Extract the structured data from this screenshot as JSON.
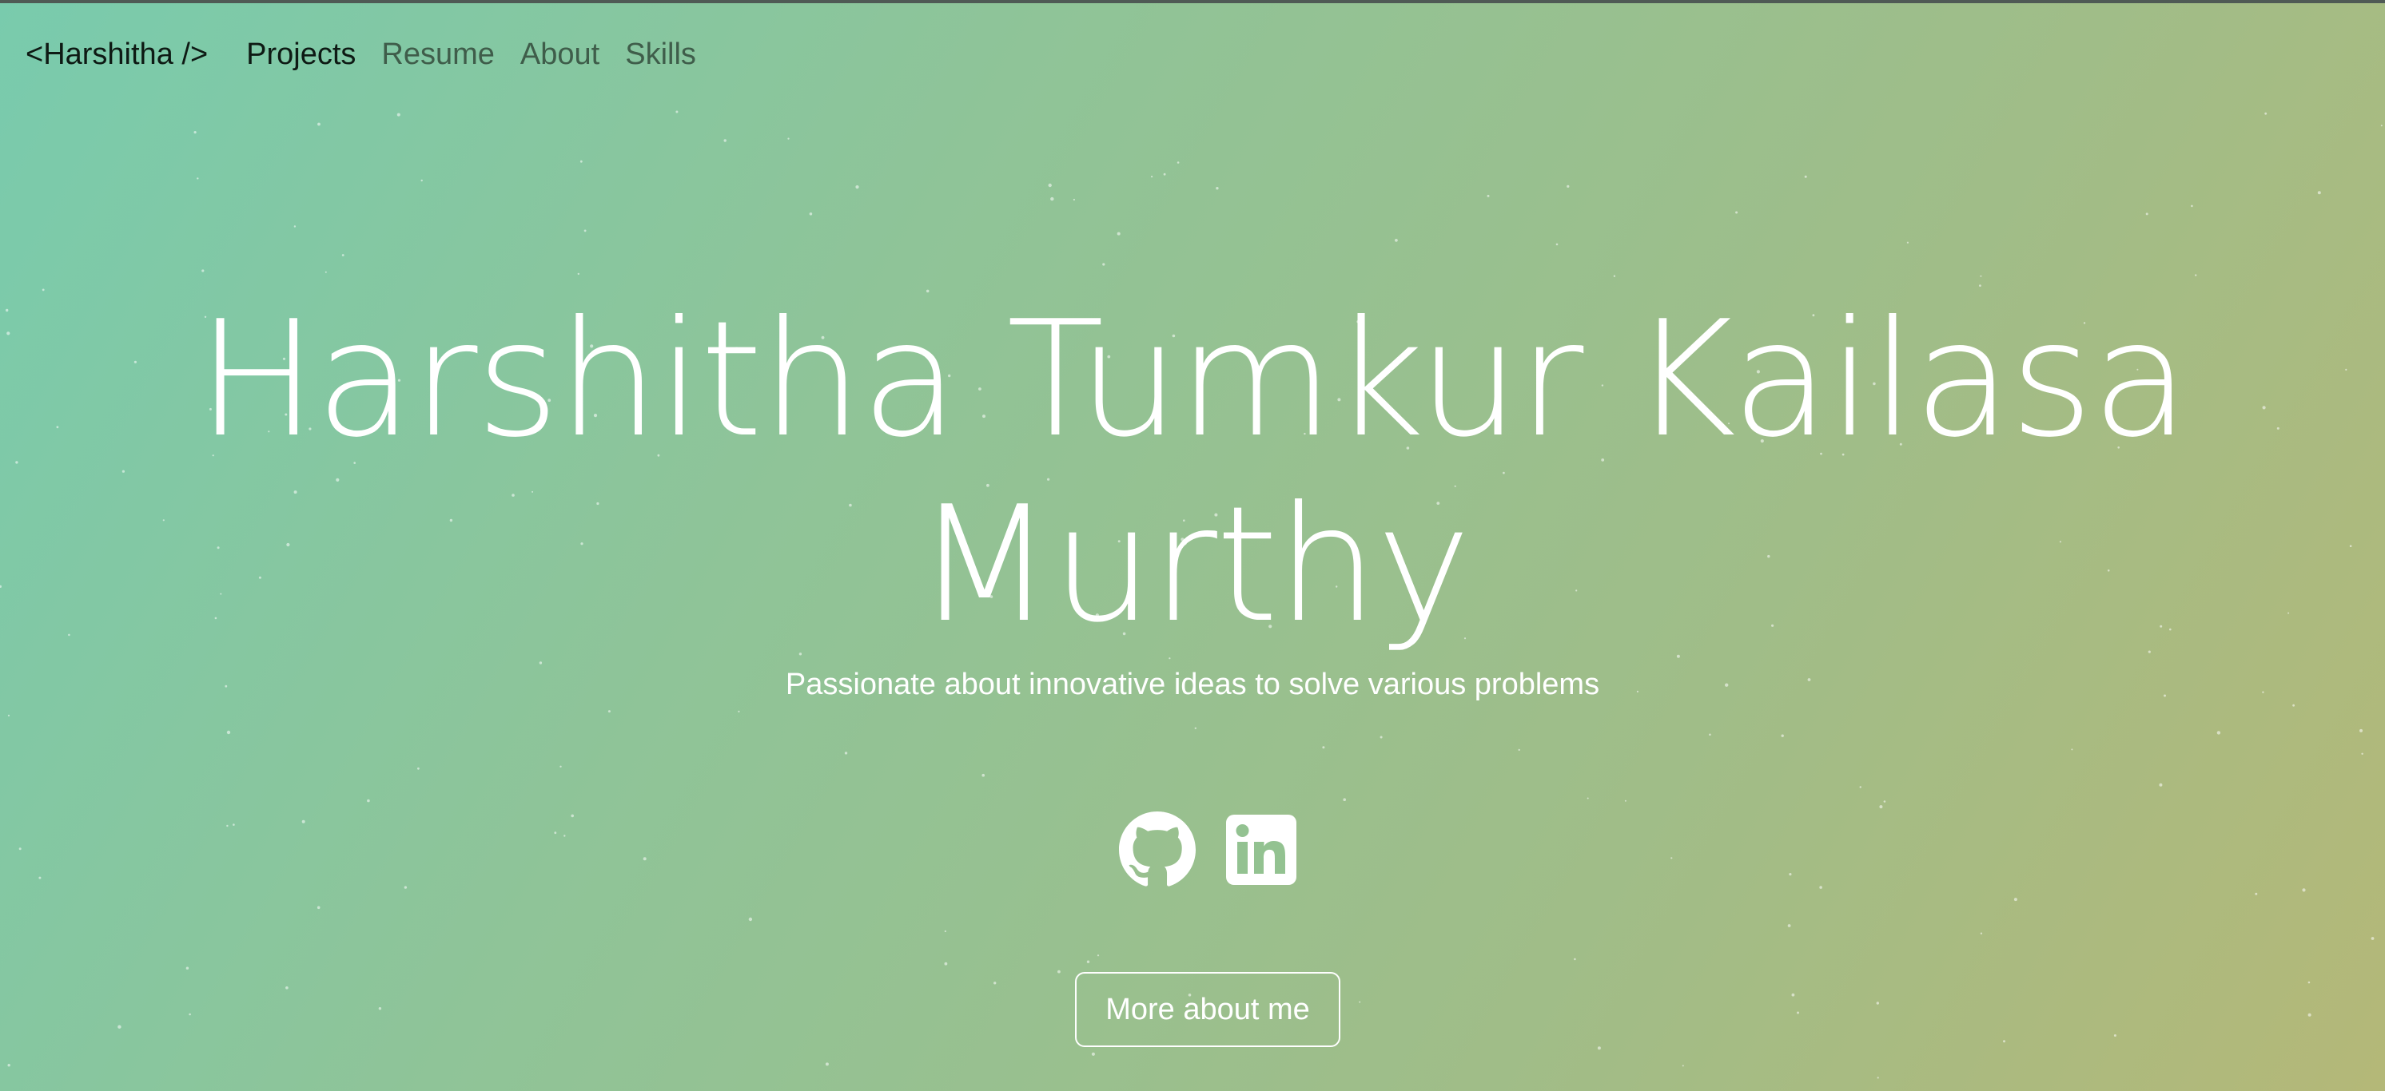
{
  "navbar": {
    "brand": "<Harshitha />",
    "links": [
      {
        "label": "Projects",
        "active": true
      },
      {
        "label": "Resume",
        "active": false
      },
      {
        "label": "About",
        "active": false
      },
      {
        "label": "Skills",
        "active": false
      }
    ]
  },
  "hero": {
    "name_line1": "Harshitha Tumkur Kailasa",
    "name_line2": "Murthy",
    "tagline": "Passionate about innovative ideas to solve various problems",
    "socials": [
      {
        "icon": "github-icon"
      },
      {
        "icon": "linkedin-icon"
      }
    ],
    "cta_label": "More about me"
  },
  "colors": {
    "gradient_start": "#79cbad",
    "gradient_end": "#b4b878",
    "text": "#ffffff",
    "nav_active": "#0e1a14",
    "nav_muted": "#3f5d4a"
  }
}
